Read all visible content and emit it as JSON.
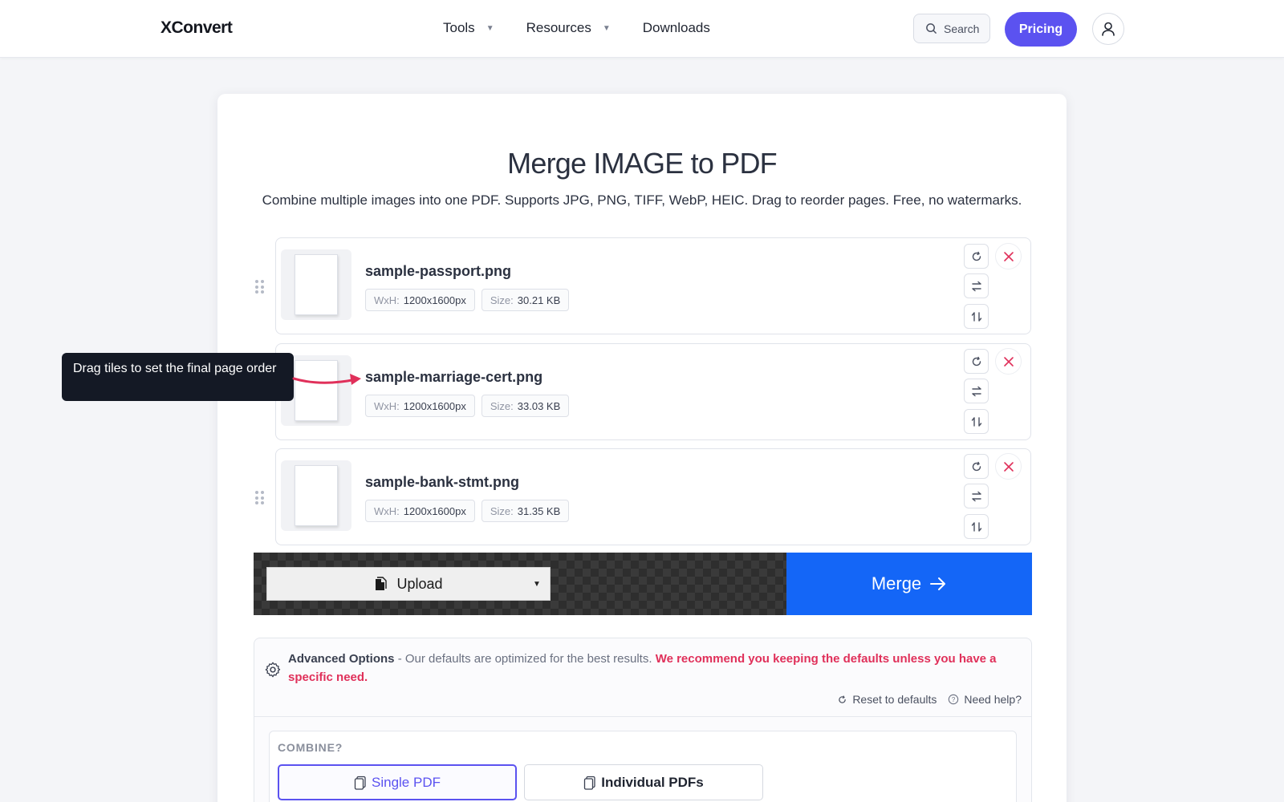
{
  "header": {
    "logo": "XConvert",
    "nav": [
      {
        "label": "Tools",
        "has_dropdown": true
      },
      {
        "label": "Resources",
        "has_dropdown": true
      },
      {
        "label": "Downloads",
        "has_dropdown": false
      }
    ],
    "search_label": "Search",
    "pricing_label": "Pricing"
  },
  "main": {
    "title": "Merge IMAGE to PDF",
    "subtitle": "Combine multiple images into one PDF. Supports JPG, PNG, TIFF, WebP, HEIC. Drag to reorder pages. Free, no watermarks.",
    "files": [
      {
        "name": "sample-passport.png",
        "dim_key": "WxH:",
        "dim_val": "1200x1600px",
        "size_key": "Size:",
        "size_val": "30.21 KB"
      },
      {
        "name": "sample-marriage-cert.png",
        "dim_key": "WxH:",
        "dim_val": "1200x1600px",
        "size_key": "Size:",
        "size_val": "33.03 KB"
      },
      {
        "name": "sample-bank-stmt.png",
        "dim_key": "WxH:",
        "dim_val": "1200x1600px",
        "size_key": "Size:",
        "size_val": "31.35 KB"
      }
    ],
    "tooltip": "Drag tiles to set the final page order",
    "upload_label": "Upload",
    "merge_label": "Merge"
  },
  "advanced": {
    "title": "Advanced Options",
    "desc": " - Our defaults are optimized for the best results. ",
    "warning": "We recommend you keeping the defaults unless you have a specific need.",
    "reset_label": "Reset to defaults",
    "help_label": "Need help?",
    "combine_label": "COMBINE?",
    "options": [
      "Single PDF",
      "Individual PDFs"
    ],
    "selected_option": "Single PDF"
  },
  "colors": {
    "accent": "#5b52f0",
    "merge_blue": "#1466f7",
    "danger": "#e0305a"
  }
}
